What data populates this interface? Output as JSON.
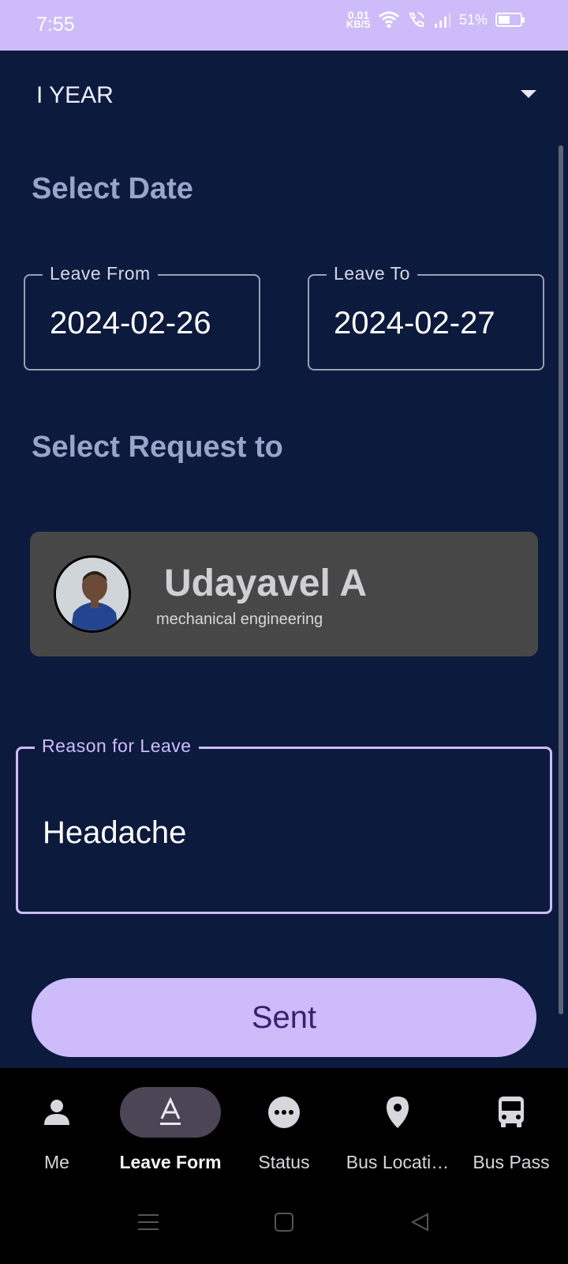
{
  "status_bar": {
    "time": "7:55",
    "network_speed_value": "0.01",
    "network_speed_unit": "KB/S",
    "battery_percent": "51%"
  },
  "year_select": {
    "value": "I YEAR"
  },
  "date_section": {
    "title": "Select Date",
    "leave_from": {
      "label": "Leave From",
      "value": "2024-02-26"
    },
    "leave_to": {
      "label": "Leave To",
      "value": "2024-02-27"
    }
  },
  "request_section": {
    "title": "Select Request to",
    "contact": {
      "name": "Udayavel A",
      "department": "mechanical engineering"
    }
  },
  "reason_field": {
    "label": "Reason for Leave",
    "value": "Headache"
  },
  "submit_button": {
    "label": "Sent"
  },
  "bottom_nav": {
    "items": [
      {
        "label": "Me",
        "icon": "person-icon"
      },
      {
        "label": "Leave Form",
        "icon": "text-a-icon",
        "active": true
      },
      {
        "label": "Status",
        "icon": "more-dots-icon"
      },
      {
        "label": "Bus Locati…",
        "icon": "location-pin-icon"
      },
      {
        "label": "Bus Pass",
        "icon": "bus-icon"
      }
    ]
  },
  "colors": {
    "status_bar_bg": "#cdbcf9",
    "background": "#0c1b3d",
    "accent": "#cdbcf9",
    "section_title": "#9aa3c9",
    "card_bg": "#474748",
    "nav_bg": "#000000"
  }
}
